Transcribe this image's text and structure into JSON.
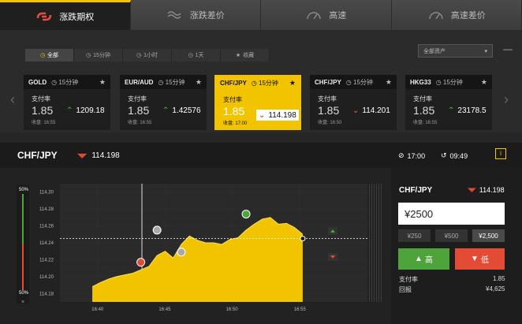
{
  "top_tabs": [
    {
      "label": "涨跌期权",
      "icon": "link-icon",
      "active": true
    },
    {
      "label": "涨跌差价",
      "icon": "wave-icon",
      "active": false
    },
    {
      "label": "高速",
      "icon": "speedometer-icon",
      "active": false
    },
    {
      "label": "高速差价",
      "icon": "speedometer-icon",
      "active": false
    }
  ],
  "filter_tabs": [
    {
      "label": "全部",
      "icon": "clock-icon",
      "active": true
    },
    {
      "label": "15分钟",
      "icon": "clock-icon"
    },
    {
      "label": "1小时",
      "icon": "clock-icon"
    },
    {
      "label": "1天",
      "icon": "clock-icon"
    },
    {
      "label": "收藏",
      "icon": "star-icon"
    }
  ],
  "asset_select": "全部资产",
  "minimize": "—",
  "cards": [
    {
      "pair": "GOLD",
      "timeframe": "15分钟",
      "payout_label": "支付率",
      "payout": "1.85",
      "price": "1209.18",
      "trend": "up",
      "close_time": "收盘: 16:55"
    },
    {
      "pair": "EUR/AUD",
      "timeframe": "15分钟",
      "payout_label": "支付率",
      "payout": "1.85",
      "price": "1.42576",
      "trend": "up",
      "close_time": "收盘: 16:55"
    },
    {
      "pair": "CHF/JPY",
      "timeframe": "15分钟",
      "payout_label": "支付率",
      "payout": "1.85",
      "price": "114.198",
      "trend": "down",
      "close_time": "收盘: 17:00",
      "active": true
    },
    {
      "pair": "CHF/JPY",
      "timeframe": "15分钟",
      "payout_label": "支付率",
      "payout": "1.85",
      "price": "114.201",
      "trend": "down",
      "close_time": "收盘: 16:50"
    },
    {
      "pair": "HKG33",
      "timeframe": "15分钟",
      "payout_label": "支付率",
      "payout": "1.85",
      "price": "23178.5",
      "trend": "up",
      "close_time": "收盘: 16:55"
    }
  ],
  "selected": {
    "pair": "CHF/JPY",
    "price": "114.198",
    "expiry": "17:00",
    "countdown": "09:49"
  },
  "chart_data": {
    "type": "area",
    "y_ticks": [
      "114.30",
      "114.28",
      "114.26",
      "114.24",
      "114.22",
      "114.20",
      "114.18"
    ],
    "x_ticks": [
      "16:40",
      "16:45",
      "16:50",
      "16:55"
    ],
    "ylim": [
      114.17,
      114.31
    ],
    "x": [
      16.66,
      16.67,
      16.68,
      16.69,
      16.7,
      16.71,
      16.72,
      16.73,
      16.74,
      16.75,
      16.76,
      16.77,
      16.78,
      16.79,
      16.8,
      16.81,
      16.82,
      16.83,
      16.84,
      16.85,
      16.86,
      16.87,
      16.88,
      16.89,
      16.9,
      16.91,
      16.92
    ],
    "price_series": [
      114.188,
      114.193,
      114.197,
      114.2,
      114.202,
      114.204,
      114.208,
      114.212,
      114.225,
      114.23,
      114.222,
      114.238,
      114.248,
      114.243,
      114.24,
      114.24,
      114.238,
      114.244,
      114.246,
      114.255,
      114.262,
      114.268,
      114.27,
      114.262,
      114.263,
      114.258,
      114.25
    ],
    "current_price": 114.245,
    "left_bar_top": "50%",
    "left_bar_bottom": "50%",
    "left_bar_close": "×"
  },
  "trade": {
    "pair": "CHF/JPY",
    "price": "114.198",
    "amount": "¥2500",
    "quick_amounts": [
      "¥250",
      "¥500",
      "¥2,500"
    ],
    "up_label": "高",
    "down_label": "低",
    "payout_label": "支付率",
    "payout_value": "1.85",
    "return_label": "回报",
    "return_value": "¥4,625"
  },
  "colors": {
    "accent": "#f2c400",
    "up": "#4ea33a",
    "down": "#e34b35"
  }
}
